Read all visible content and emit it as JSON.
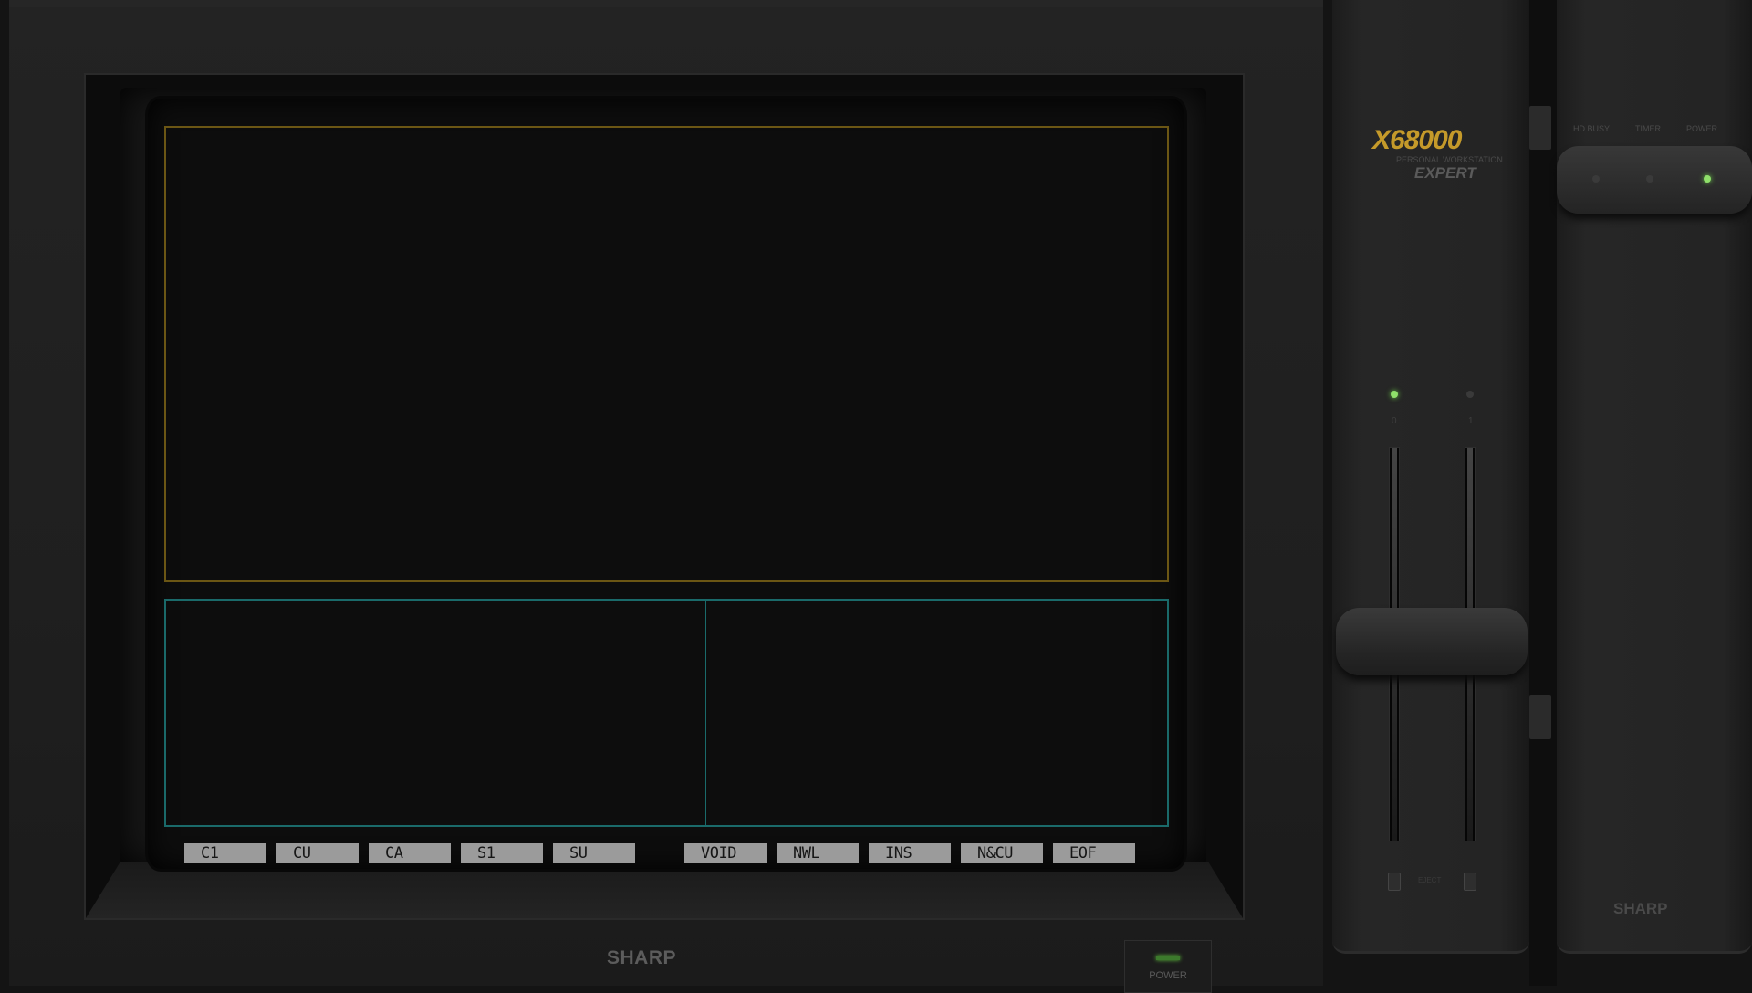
{
  "monitor": {
    "brand": "SHARP",
    "power_label": "POWER",
    "function_keys": [
      "C1",
      "CU",
      "CA",
      "S1",
      "SU",
      "VOID",
      "NWL",
      "INS",
      "N&CU",
      "EOF"
    ]
  },
  "unit": {
    "logo": "X68000",
    "logo_subtitle": "PERSONAL WORKSTATION",
    "logo_model": "EXPERT",
    "drive_numbers": [
      "0",
      "1"
    ],
    "eject_label": "EJECT",
    "status_labels": [
      "HD BUSY",
      "TIMER",
      "POWER"
    ],
    "brand": "SHARP"
  },
  "colors": {
    "upper_pane_border": "#6b5614",
    "lower_pane_border": "#1a6a6a",
    "led_on": "#8fe06a",
    "logo_gold": "#c59a2a"
  },
  "led_state": {
    "drive0": "on",
    "drive1": "off",
    "hd_busy": "off",
    "timer": "off",
    "power": "on"
  }
}
